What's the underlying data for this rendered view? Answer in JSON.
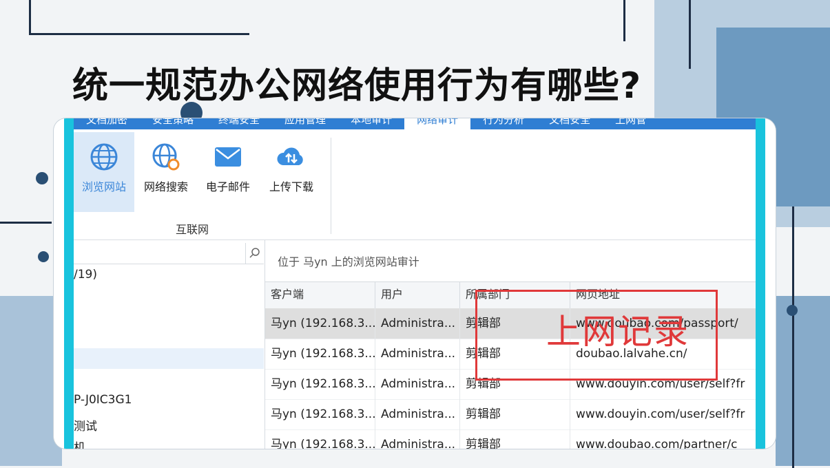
{
  "title": "统一规范办公网络使用行为有哪些?",
  "colors": {
    "accent": "#2f7ed3",
    "cyan_frame": "#19c3dd",
    "annotation": "#e0393a",
    "selected_button": "#dbe9f8"
  },
  "tabs": [
    "文档加密",
    "安全策略",
    "终端安全",
    "应用管理",
    "本地审计",
    "网络审计",
    "行为分析",
    "文档安全",
    "上网管"
  ],
  "ribbon": {
    "buttons": [
      {
        "label": "浏览网站",
        "icon": "globe-icon",
        "active": true
      },
      {
        "label": "网络搜索",
        "icon": "globe-search-icon",
        "active": false
      },
      {
        "label": "电子邮件",
        "icon": "envelope-icon",
        "active": false
      },
      {
        "label": "上传下载",
        "icon": "cloud-transfer-icon",
        "active": false
      }
    ],
    "group_label": "互联网"
  },
  "tree": {
    "search_icon": "search-icon",
    "items": [
      "/19)",
      "",
      "P-J0IC3G1",
      "测试",
      "机"
    ]
  },
  "grid": {
    "breadcrumb": "位于 马yn 上的浏览网站审计",
    "columns": [
      "客户端",
      "用户",
      "所属部门",
      "网页地址"
    ],
    "rows": [
      {
        "client": "马yn (192.168.3...",
        "user": "Administra...",
        "dept": "剪辑部",
        "url": "www.doubao.com/passport/",
        "selected": true
      },
      {
        "client": "马yn (192.168.3...",
        "user": "Administra...",
        "dept": "剪辑部",
        "url": "doubao.lalvahe.cn/",
        "selected": false
      },
      {
        "client": "马yn (192.168.3...",
        "user": "Administra...",
        "dept": "剪辑部",
        "url": "www.douyin.com/user/self?fr",
        "selected": false
      },
      {
        "client": "马yn (192.168.3...",
        "user": "Administra...",
        "dept": "剪辑部",
        "url": "www.douyin.com/user/self?fr",
        "selected": false
      },
      {
        "client": "马yn (192.168.3...",
        "user": "Administra...",
        "dept": "剪辑部",
        "url": "www.doubao.com/partner/c",
        "selected": false
      }
    ]
  },
  "annotation": "上网记录"
}
